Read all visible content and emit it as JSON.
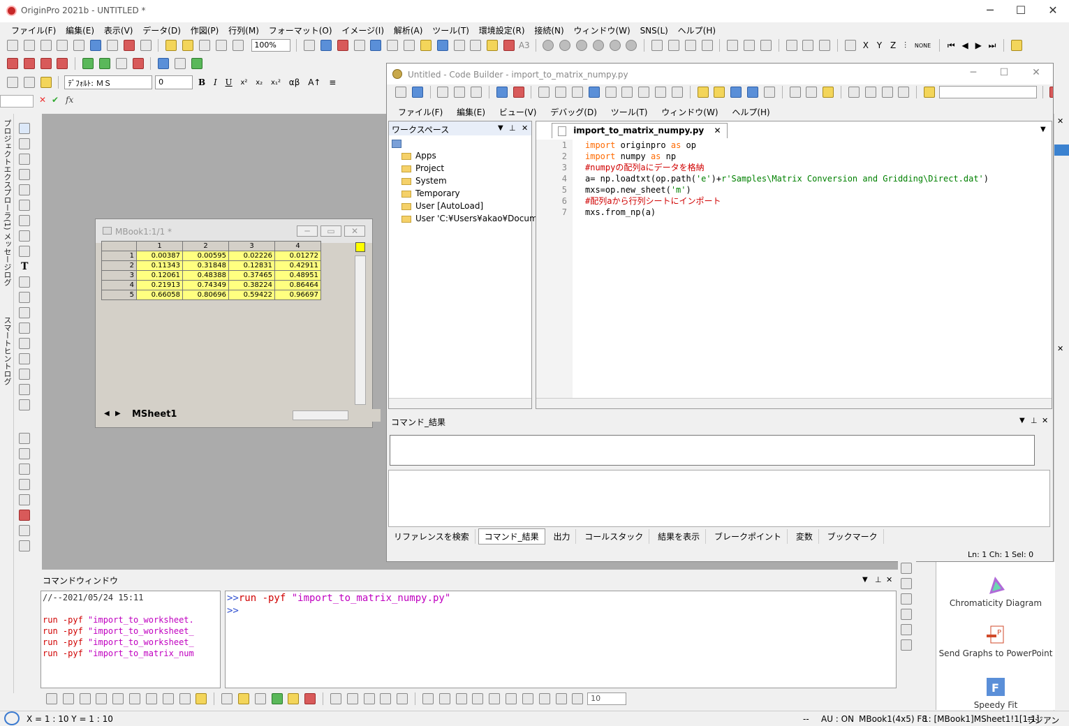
{
  "app": {
    "title": "OriginPro 2021b - UNTITLED *"
  },
  "menu": [
    "ファイル(F)",
    "編集(E)",
    "表示(V)",
    "データ(D)",
    "作図(P)",
    "行列(M)",
    "フォーマット(O)",
    "イメージ(I)",
    "解析(A)",
    "ツール(T)",
    "環境設定(R)",
    "接続(N)",
    "ウィンドウ(W)",
    "SNS(L)",
    "ヘルプ(H)"
  ],
  "toolbar": {
    "zoom": "100%",
    "font": "ﾃﾞﾌｫﾙﾄ: ＭＳ",
    "fontsize": "0",
    "fx": "fx",
    "a3": "A3",
    "none": "NONE",
    "bold": "B",
    "italic": "I",
    "underline": "U",
    "greek": "αβ",
    "lineWidth": "10"
  },
  "leftTabs": [
    "プロジェクトエクスプローラ(1)",
    "メッセージログ",
    "スマートヒントログ"
  ],
  "mbook": {
    "title": "MBook1:1/1 *",
    "columns": [
      "1",
      "2",
      "3",
      "4"
    ],
    "rows": [
      {
        "h": "1",
        "v": [
          "0.00387",
          "0.00595",
          "0.02226",
          "0.01272"
        ]
      },
      {
        "h": "2",
        "v": [
          "0.11343",
          "0.31848",
          "0.12831",
          "0.42911"
        ]
      },
      {
        "h": "3",
        "v": [
          "0.12061",
          "0.48388",
          "0.37465",
          "0.48951"
        ]
      },
      {
        "h": "4",
        "v": [
          "0.21913",
          "0.74349",
          "0.38224",
          "0.86464"
        ]
      },
      {
        "h": "5",
        "v": [
          "0.66058",
          "0.80696",
          "0.59422",
          "0.96697"
        ]
      }
    ],
    "sheet": "MSheet1"
  },
  "codebuilder": {
    "title": "Untitled - Code Builder - import_to_matrix_numpy.py",
    "menu": [
      "ファイル(F)",
      "編集(E)",
      "ビュー(V)",
      "デバッグ(D)",
      "ツール(T)",
      "ウィンドウ(W)",
      "ヘルプ(H)"
    ],
    "workspace": {
      "title": "ワークスペース",
      "items": [
        "Apps",
        "Project",
        "System",
        "Temporary",
        "User [AutoLoad]",
        "User 'C:¥Users¥akao¥Document"
      ]
    },
    "tab": "import_to_matrix_numpy.py",
    "code": {
      "l1kw": "import",
      "l1a": " originpro ",
      "l1kw2": "as",
      "l1b": " op",
      "l2kw": "import",
      "l2a": " numpy ",
      "l2kw2": "as",
      "l2b": " np",
      "l3": "#numpyの配列aにデータを格納",
      "l4a": "a= np.loadtxt(op.path(",
      "l4s1": "'e'",
      "l4b": ")+",
      "l4s2": "r'Samples\\Matrix Conversion and Gridding\\Direct.dat'",
      "l4c": ")",
      "l5a": "mxs=op.new_sheet(",
      "l5s": "'m'",
      "l5b": ")",
      "l6": "#配列aから行列シートにインポート",
      "l7": "mxs.from_np(a)"
    },
    "lineNumbers": [
      "1",
      "2",
      "3",
      "4",
      "5",
      "6",
      "7"
    ],
    "cmdres": {
      "title": "コマンド_結果",
      "tabs": [
        "リファレンスを検索",
        "コマンド_結果",
        "出力",
        "コールスタック",
        "結果を表示",
        "ブレークポイント",
        "変数",
        "ブックマーク"
      ]
    },
    "status": "Ln: 1 Ch: 1 Sel: 0"
  },
  "cmdwin": {
    "title": "コマンドウィンドウ",
    "history_date": "//--2021/05/24 15:11",
    "history": [
      {
        "cmd": "run -pyf ",
        "arg": "\"import_to_worksheet."
      },
      {
        "cmd": "run -pyf ",
        "arg": "\"import_to_worksheet_"
      },
      {
        "cmd": "run -pyf ",
        "arg": "\"import_to_worksheet_"
      },
      {
        "cmd": "run -pyf ",
        "arg": "\"import_to_matrix_num"
      }
    ],
    "prompt": ">>",
    "input_cmd": "run -pyf ",
    "input_arg": "\"import_to_matrix_numpy.py\"",
    "prompt2": ">>"
  },
  "rightPanel": [
    {
      "label": "Chromaticity Diagram"
    },
    {
      "label": "Send Graphs to PowerPoint"
    },
    {
      "label": "Speedy Fit"
    }
  ],
  "statusbar": {
    "coords": "X = 1 : 10   Y = 1 : 10",
    "dashes": "--",
    "au": "AU : ON",
    "book": "MBook1(4x5) F8",
    "sheet": "1: [MBook1]MSheet1!1[1:1]",
    "unit": "ラジアン"
  }
}
